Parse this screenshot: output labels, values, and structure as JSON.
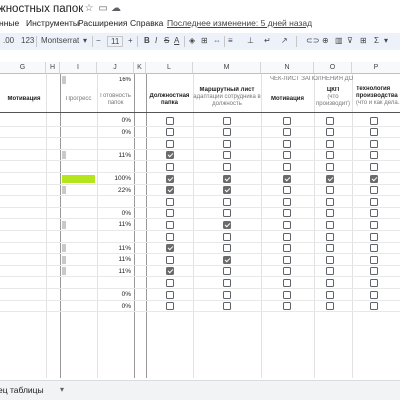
{
  "app": {
    "doc_title": "жностных папок",
    "menus": [
      "нные",
      "Инструменты",
      "Расширения",
      "Справка"
    ],
    "last_edit": "Последнее изменение: 5 дней назад"
  },
  "toolbar": {
    "font": "Montserrat",
    "size": "11",
    "bold": "B",
    "italic": "I",
    "strike": "S",
    "text_color": "A",
    "sigma": "Σ"
  },
  "columns": [
    "G",
    "H",
    "I",
    "J",
    "K",
    "L",
    "M",
    "N",
    "O",
    "P"
  ],
  "header": {
    "motivation_g": "Мотивация",
    "progress": "Прогресс",
    "readiness": "Готовность папок",
    "readiness_pct": "16%",
    "checklist": "ЧЕК-ЛИСТ ЗАПОЛНЕНИЯ ДО",
    "col_l": "Должностная папка",
    "col_m": "Маршрутный лист",
    "col_m_sub": "адаптации сотрудника в должность",
    "col_n": "Мотивация",
    "col_o": "ЦКП",
    "col_o_sub": "(что производит)",
    "col_p": "Технология производства",
    "col_p_sub": "(что и как дела..."
  },
  "rows": [
    {
      "pct": "0%",
      "bar": 0,
      "l": false,
      "m": false,
      "n": false,
      "o": false,
      "p": false
    },
    {
      "pct": "0%",
      "bar": 0,
      "l": false,
      "m": false,
      "n": false,
      "o": false,
      "p": false
    },
    {
      "pct": "",
      "bar": 0,
      "l": false,
      "m": false,
      "n": false,
      "o": false,
      "p": false
    },
    {
      "pct": "11%",
      "bar": 0.11,
      "l": true,
      "m": false,
      "n": false,
      "o": false,
      "p": false
    },
    {
      "pct": "",
      "bar": 0,
      "l": false,
      "m": false,
      "n": false,
      "o": false,
      "p": false
    },
    {
      "pct": "100%",
      "bar": 1.0,
      "l": true,
      "m": true,
      "n": true,
      "o": true,
      "p": true
    },
    {
      "pct": "22%",
      "bar": 0.22,
      "l": true,
      "m": true,
      "n": false,
      "o": false,
      "p": false
    },
    {
      "pct": "",
      "bar": 0,
      "l": false,
      "m": false,
      "n": false,
      "o": false,
      "p": false
    },
    {
      "pct": "0%",
      "bar": 0,
      "l": false,
      "m": false,
      "n": false,
      "o": false,
      "p": false
    },
    {
      "pct": "11%",
      "bar": 0.11,
      "l": false,
      "m": true,
      "n": false,
      "o": false,
      "p": false
    },
    {
      "pct": "",
      "bar": 0,
      "l": false,
      "m": false,
      "n": false,
      "o": false,
      "p": false
    },
    {
      "pct": "11%",
      "bar": 0.11,
      "l": true,
      "m": false,
      "n": false,
      "o": false,
      "p": false
    },
    {
      "pct": "11%",
      "bar": 0.11,
      "l": false,
      "m": true,
      "n": false,
      "o": false,
      "p": false
    },
    {
      "pct": "11%",
      "bar": 0.11,
      "l": true,
      "m": false,
      "n": false,
      "o": false,
      "p": false
    },
    {
      "pct": "",
      "bar": 0,
      "l": false,
      "m": false,
      "n": false,
      "o": false,
      "p": false
    },
    {
      "pct": "0%",
      "bar": 0,
      "l": false,
      "m": false,
      "n": false,
      "o": false,
      "p": false
    },
    {
      "pct": "0%",
      "bar": 0,
      "l": false,
      "m": false,
      "n": false,
      "o": false,
      "p": false
    }
  ],
  "footer": {
    "sheet_tab": "ец таблицы"
  },
  "colors": {
    "bar_full": "#b5e61d",
    "bar_partial": "#c9c9c9",
    "checked": "#6b6b6b",
    "toolbar_bg": "#edf2fa"
  }
}
